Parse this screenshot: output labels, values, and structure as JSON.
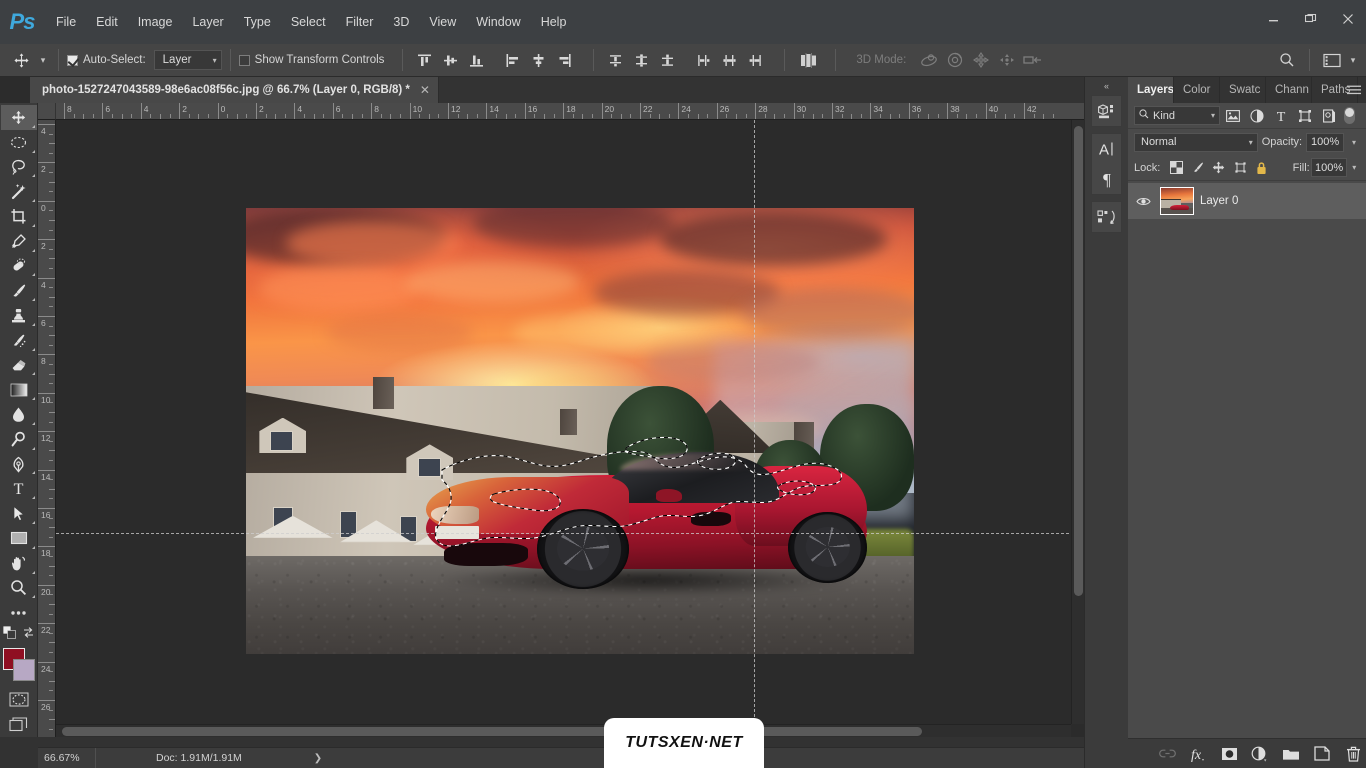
{
  "app": {
    "name": "Ps",
    "logo_color": "#3fa9dd"
  },
  "menubar": {
    "items": [
      "File",
      "Edit",
      "Image",
      "Layer",
      "Type",
      "Select",
      "Filter",
      "3D",
      "View",
      "Window",
      "Help"
    ]
  },
  "window_controls": {
    "minimize": "minimize-icon",
    "restore": "restore-icon",
    "close": "close-icon"
  },
  "options_bar": {
    "tool_icon": "move-tool-icon",
    "auto_select_checked": true,
    "auto_select_label": "Auto-Select:",
    "auto_select_value": "Layer",
    "show_transform_checked": false,
    "show_transform_label": "Show Transform Controls",
    "align_group_1": [
      "align-top-edges-icon",
      "align-vertical-centers-icon",
      "align-bottom-edges-icon"
    ],
    "align_group_2": [
      "align-left-edges-icon",
      "align-horizontal-centers-icon",
      "align-right-edges-icon"
    ],
    "distribute_group_1": [
      "distribute-top-edges-icon",
      "distribute-vertical-centers-icon",
      "distribute-bottom-edges-icon"
    ],
    "distribute_group_2": [
      "distribute-left-edges-icon",
      "distribute-horizontal-centers-icon",
      "distribute-right-edges-icon"
    ],
    "auto_align_icon": "auto-align-layers-icon",
    "mode_3d_label": "3D Mode:",
    "mode_3d_enabled": false,
    "mode_3d_icons": [
      "orbit-3d-icon",
      "roll-3d-icon",
      "pan-3d-icon",
      "slide-3d-icon",
      "scale-3d-icon"
    ],
    "search_icon": "search-icon",
    "workspace_icon": "workspace-switcher-icon",
    "workspace_caret": "chevron-down-icon"
  },
  "document_tab": {
    "title": "photo-1527247043589-98e6ac08f56c.jpg @ 66.7%  (Layer 0, RGB/8) *",
    "close": "close-icon"
  },
  "toolbar": {
    "tools": [
      {
        "name": "move-tool",
        "glyph": "move",
        "active": true
      },
      {
        "name": "elliptical-marquee-tool",
        "glyph": "ellipse"
      },
      {
        "name": "lasso-tool",
        "glyph": "lasso"
      },
      {
        "name": "magic-wand-tool",
        "glyph": "wand"
      },
      {
        "name": "crop-tool",
        "glyph": "crop"
      },
      {
        "name": "eyedropper-tool",
        "glyph": "eyedropper"
      },
      {
        "name": "healing-brush-tool",
        "glyph": "healing"
      },
      {
        "name": "brush-tool",
        "glyph": "brush"
      },
      {
        "name": "clone-stamp-tool",
        "glyph": "stamp"
      },
      {
        "name": "history-brush-tool",
        "glyph": "history-brush"
      },
      {
        "name": "eraser-tool",
        "glyph": "eraser"
      },
      {
        "name": "gradient-tool",
        "glyph": "gradient"
      },
      {
        "name": "blur-tool",
        "glyph": "blur"
      },
      {
        "name": "dodge-tool",
        "glyph": "dodge"
      },
      {
        "name": "pen-tool",
        "glyph": "pen"
      },
      {
        "name": "horizontal-type-tool",
        "glyph": "type"
      },
      {
        "name": "path-selection-tool",
        "glyph": "arrow"
      },
      {
        "name": "rectangle-tool",
        "glyph": "rectangle"
      },
      {
        "name": "hand-tool",
        "glyph": "hand"
      },
      {
        "name": "zoom-tool",
        "glyph": "zoom"
      },
      {
        "name": "edit-toolbar-tool",
        "glyph": "ellipsis"
      }
    ],
    "foreground_color": "#8f0f22",
    "background_color": "#b7a8c4",
    "swap_icon": "swap-colors-icon",
    "default_colors_icon": "default-colors-icon",
    "quick_mask_icon": "quick-mask-icon",
    "screen_mode_icon": "screen-mode-icon"
  },
  "rulers": {
    "unit": "cm",
    "horizontal_labels": [
      "8",
      "6",
      "4",
      "2",
      "0",
      "2",
      "4",
      "6",
      "8",
      "10",
      "12",
      "14",
      "16",
      "18",
      "20",
      "22",
      "24",
      "26",
      "28",
      "30",
      "32",
      "34",
      "36",
      "38",
      "40",
      "42"
    ],
    "vertical_labels": [
      "4",
      "2",
      "0",
      "2",
      "4",
      "6",
      "8",
      "10",
      "12",
      "14",
      "16",
      "18",
      "20",
      "22",
      "24",
      "26"
    ]
  },
  "canvas": {
    "image": {
      "description": "Red Ferrari 458 sports car parked in front of a stone chateau at dramatic fiery orange sunset",
      "selection_active": true,
      "selection_type": "marching-ants-lasso",
      "cursor": "move-cursor"
    }
  },
  "watermark": {
    "text": "TUTSXEN·NET"
  },
  "status_bar": {
    "zoom": "66.67%",
    "doc_label": "Doc: 1.91M/1.91M",
    "expand_arrow": "chevron-right-icon"
  },
  "dock_mini": {
    "collapse_icon": "collapse-panels-icon",
    "icons": [
      {
        "name": "properties-panel-icon",
        "glyph": "cube"
      },
      {
        "name": "character-panel-icon",
        "glyph": "A"
      },
      {
        "name": "paragraph-panel-icon",
        "glyph": "pilcrow"
      },
      {
        "name": "actions-panel-icon",
        "glyph": "actions"
      }
    ]
  },
  "layers_panel": {
    "tabs": [
      {
        "label": "Layers",
        "active": true
      },
      {
        "label": "Color",
        "active": false
      },
      {
        "label": "Swatc",
        "active": false
      },
      {
        "label": "Chann",
        "active": false
      },
      {
        "label": "Paths",
        "active": false
      }
    ],
    "menu_icon": "panel-menu-icon",
    "filter": {
      "kind_label": "Kind",
      "search_icon": "search-icon",
      "caret": "chevron-down-icon",
      "filter_icons": [
        {
          "name": "filter-pixel-layers-icon",
          "glyph": "image"
        },
        {
          "name": "filter-adjustment-layers-icon",
          "glyph": "half-circle"
        },
        {
          "name": "filter-type-layers-icon",
          "glyph": "T"
        },
        {
          "name": "filter-shape-layers-icon",
          "glyph": "shape"
        },
        {
          "name": "filter-smart-objects-icon",
          "glyph": "smart"
        }
      ],
      "toggle_on": true
    },
    "blend_mode": "Normal",
    "opacity_label": "Opacity:",
    "opacity_value": "100%",
    "lock_label": "Lock:",
    "lock_icons": [
      {
        "name": "lock-transparent-pixels-icon",
        "glyph": "checker"
      },
      {
        "name": "lock-image-pixels-icon",
        "glyph": "brush"
      },
      {
        "name": "lock-position-icon",
        "glyph": "move"
      },
      {
        "name": "lock-artboard-nesting-icon",
        "glyph": "artboard"
      },
      {
        "name": "lock-all-icon",
        "glyph": "lock"
      }
    ],
    "fill_label": "Fill:",
    "fill_value": "100%",
    "layers": [
      {
        "name": "Layer 0",
        "visible": true,
        "selected": true,
        "thumbnail": "car-sunset-thumbnail"
      }
    ],
    "footer_icons": [
      {
        "name": "link-layers-icon",
        "glyph": "link",
        "dimmed": true
      },
      {
        "name": "add-layer-style-icon",
        "glyph": "fx"
      },
      {
        "name": "add-layer-mask-icon",
        "glyph": "mask"
      },
      {
        "name": "new-adjustment-layer-icon",
        "glyph": "adjustment"
      },
      {
        "name": "new-group-icon",
        "glyph": "folder"
      },
      {
        "name": "new-layer-icon",
        "glyph": "new-layer"
      },
      {
        "name": "delete-layer-icon",
        "glyph": "trash"
      }
    ]
  }
}
